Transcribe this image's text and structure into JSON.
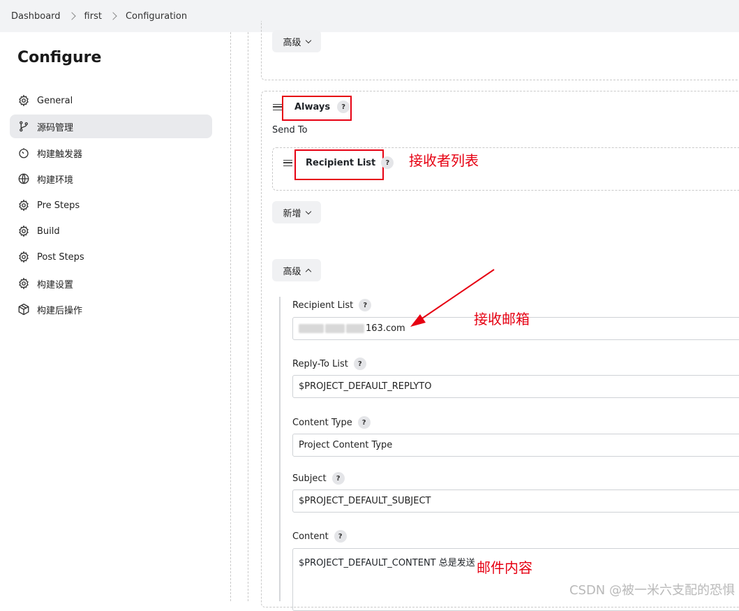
{
  "breadcrumb": [
    "Dashboard",
    "first",
    "Configuration"
  ],
  "sidebar": {
    "title": "Configure",
    "items": [
      {
        "label": "General",
        "icon": "gear-icon"
      },
      {
        "label": "源码管理",
        "icon": "branch-icon"
      },
      {
        "label": "构建触发器",
        "icon": "clock-icon"
      },
      {
        "label": "构建环境",
        "icon": "globe-icon"
      },
      {
        "label": "Pre Steps",
        "icon": "gear-icon"
      },
      {
        "label": "Build",
        "icon": "gear-icon"
      },
      {
        "label": "Post Steps",
        "icon": "gear-icon"
      },
      {
        "label": "构建设置",
        "icon": "gear-icon"
      },
      {
        "label": "构建后操作",
        "icon": "package-icon"
      }
    ],
    "active_index": 1
  },
  "main": {
    "advanced_top_label": "高级",
    "trigger": {
      "title": "Always",
      "help": "?",
      "send_to": "Send To"
    },
    "recipient_list_block": {
      "title": "Recipient List",
      "help": "?"
    },
    "add_button_label": "新增",
    "advanced_label": "高级",
    "fields": {
      "recipient_list": {
        "label": "Recipient List",
        "value": "163.com"
      },
      "reply_to": {
        "label": "Reply-To List",
        "value": "$PROJECT_DEFAULT_REPLYTO"
      },
      "content_type": {
        "label": "Content Type",
        "value": "Project Content Type"
      },
      "subject": {
        "label": "Subject",
        "value": "$PROJECT_DEFAULT_SUBJECT"
      },
      "content": {
        "label": "Content",
        "value": "$PROJECT_DEFAULT_CONTENT 总是发送"
      }
    }
  },
  "annotations": {
    "recipient_list_note": "接收者列表",
    "mailbox_note": "接收邮箱",
    "mail_content_note": "邮件内容"
  },
  "watermark": "CSDN @被一米六支配的恐惧",
  "colors": {
    "annotation": "#e60012",
    "active_bg": "#e9eaed"
  }
}
